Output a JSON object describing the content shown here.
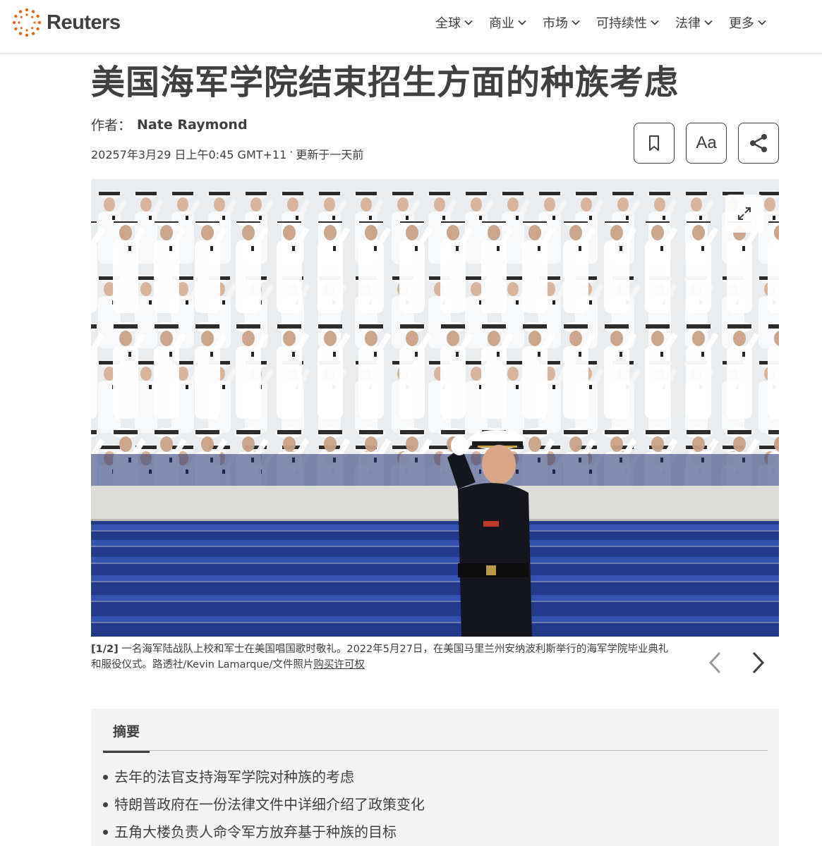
{
  "header": {
    "logo_text": "Reuters",
    "nav": [
      {
        "label": "全球"
      },
      {
        "label": "商业"
      },
      {
        "label": "市场"
      },
      {
        "label": "可持续性"
      },
      {
        "label": "法律"
      },
      {
        "label": "更多"
      }
    ]
  },
  "article": {
    "title": "美国海军学院结束招生方面的种族考虑",
    "byline_prefix": "作者：",
    "author": "Nate Raymond",
    "date": "20257年3月29 日上午0:45 GMT+11",
    "separator": "·",
    "updated": "更新于一天前",
    "tools": {
      "bookmark_icon": "bookmark-icon",
      "font_size_label": "Aa",
      "share_icon": "share-icon"
    }
  },
  "photo": {
    "expand_icon": "expand-icon",
    "caption_index": "[1/2]",
    "caption_text": " 一名海军陆战队上校和军士在美国唱国歌时敬礼。2022年5月27日，在美国马里兰州安纳波利斯举行的海军学院毕业典礼和服役仪式。路透社/Kevin Lamarque/文件照片",
    "license_link": "购买许可权",
    "prev_icon": "chevron-left-icon",
    "next_icon": "chevron-right-icon"
  },
  "summary": {
    "tab_label": "摘要",
    "items": [
      "去年的法官支持海军学院对种族的考虑",
      "特朗普政府在一份法律文件中详细介绍了政策变化",
      "五角大楼负责人命令军方放弃基于种族的目标"
    ]
  },
  "colors": {
    "text": "#404040",
    "logo_accent": "#e1671b",
    "summary_bg": "#f4f4f4",
    "stadium_blue": "#23398a"
  }
}
